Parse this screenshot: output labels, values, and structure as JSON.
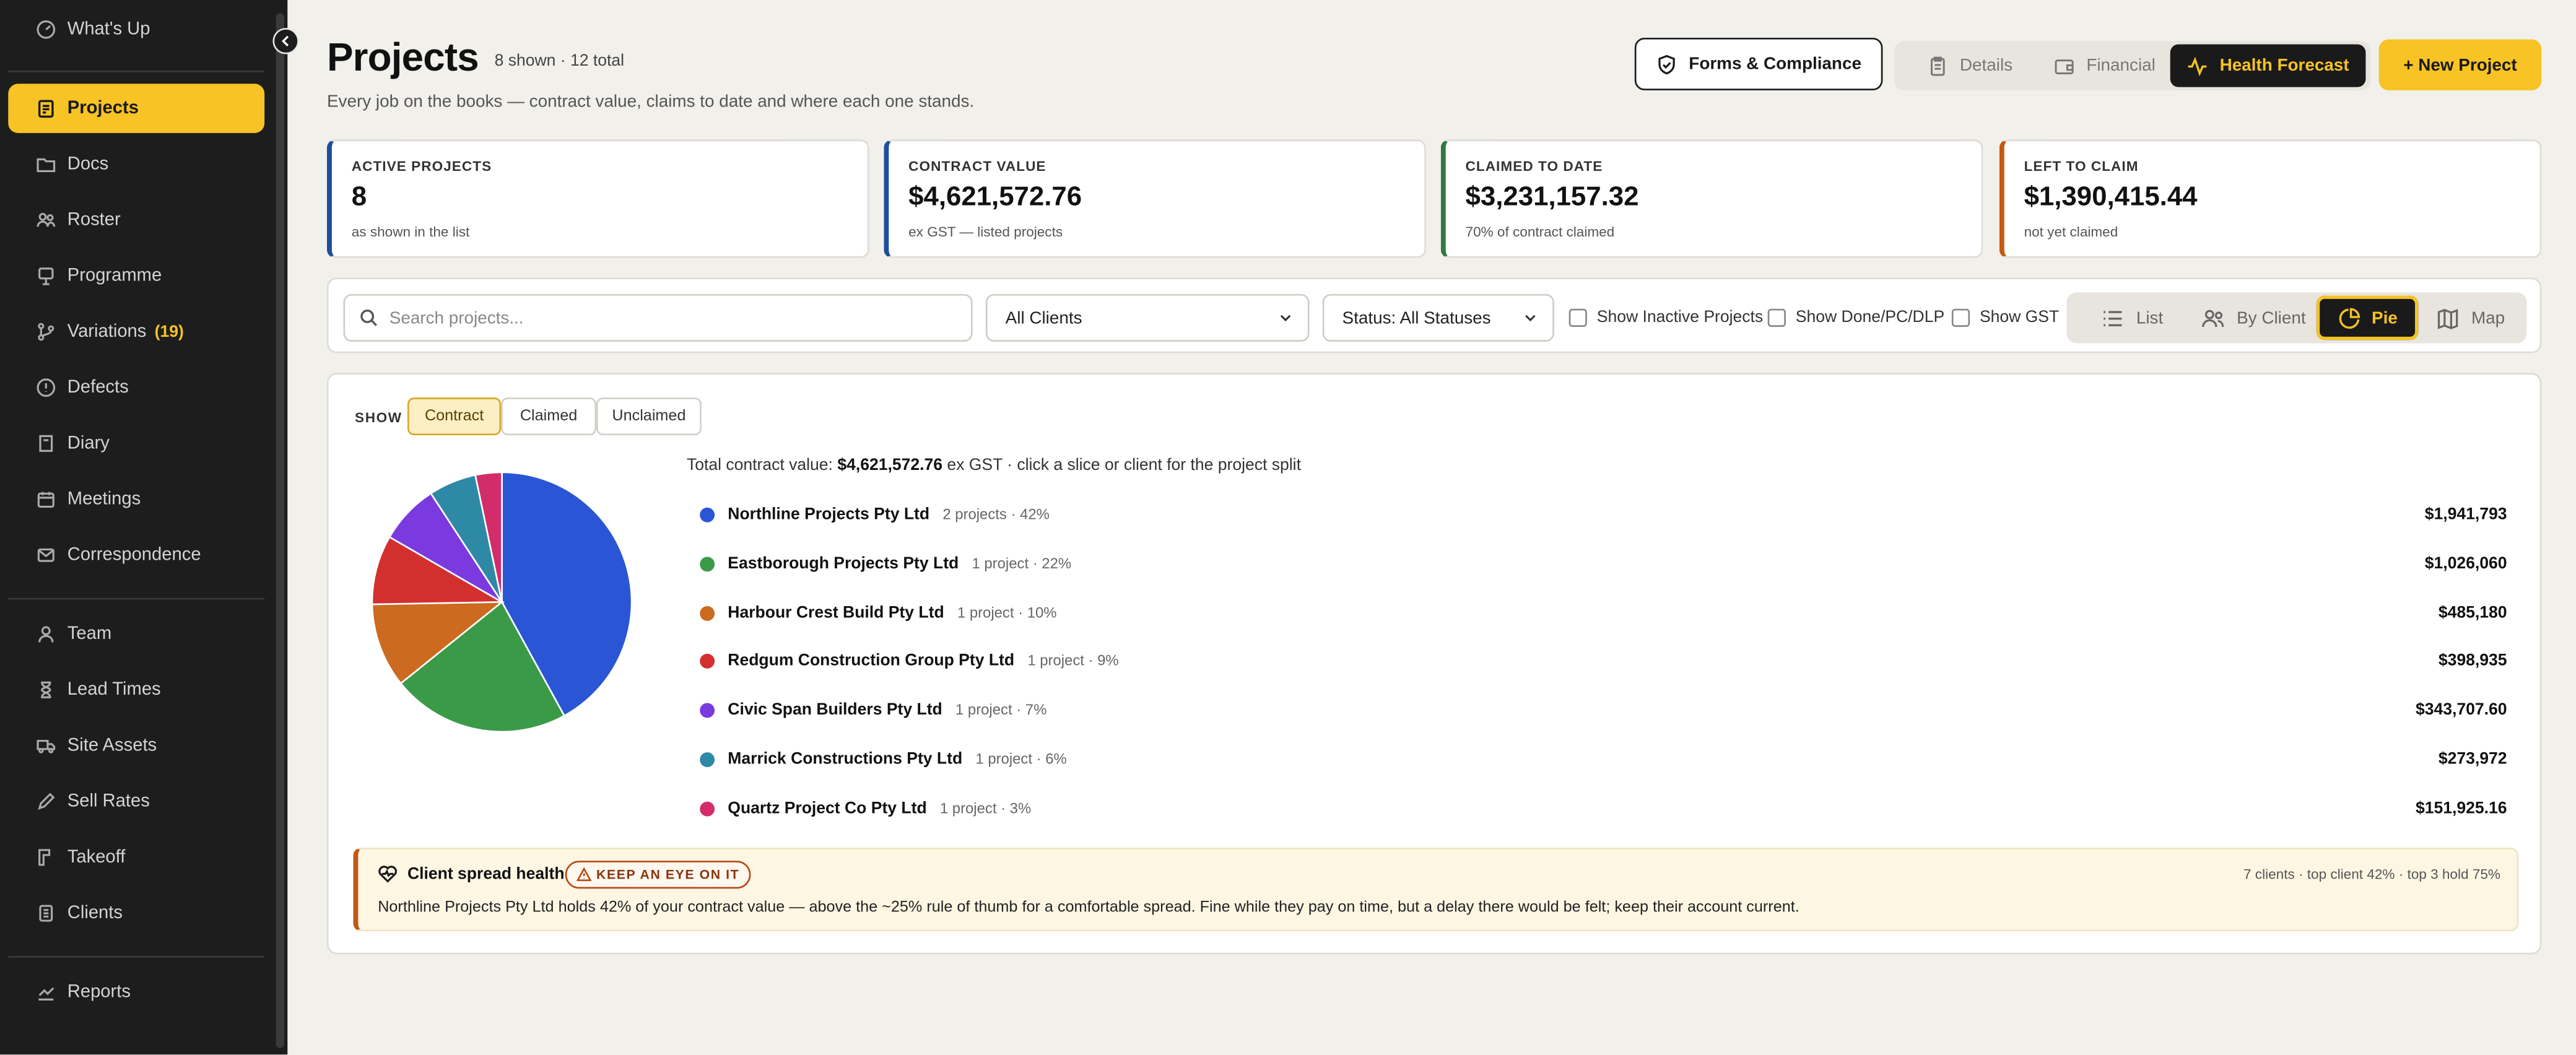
{
  "sidebar": {
    "items": [
      {
        "label": "What's Up",
        "icon": "gauge-icon"
      },
      {
        "label": "Projects",
        "icon": "clipboard-icon",
        "active": true
      },
      {
        "label": "Docs",
        "icon": "folder-icon"
      },
      {
        "label": "Roster",
        "icon": "people-icon"
      },
      {
        "label": "Programme",
        "icon": "presentation-icon"
      },
      {
        "label": "Variations",
        "icon": "branch-icon",
        "badge": "(19)"
      },
      {
        "label": "Defects",
        "icon": "alert-circle-icon"
      },
      {
        "label": "Diary",
        "icon": "book-icon"
      },
      {
        "label": "Meetings",
        "icon": "calendar-icon"
      },
      {
        "label": "Correspondence",
        "icon": "mail-icon"
      },
      {
        "label": "Team",
        "icon": "user-icon"
      },
      {
        "label": "Lead Times",
        "icon": "hourglass-icon"
      },
      {
        "label": "Site Assets",
        "icon": "truck-icon"
      },
      {
        "label": "Sell Rates",
        "icon": "pencil-icon"
      },
      {
        "label": "Takeoff",
        "icon": "ruler-icon"
      },
      {
        "label": "Clients",
        "icon": "document-icon"
      },
      {
        "label": "Reports",
        "icon": "chart-line-icon"
      }
    ]
  },
  "header": {
    "title": "Projects",
    "count": "8 shown · 12 total",
    "subtitle": "Every job on the books — contract value, claims to date and where each one stands.",
    "forms_label": "Forms & Compliance",
    "tabs": {
      "details": "Details",
      "financial": "Financial",
      "health": "Health Forecast"
    },
    "new_label": "+ New Project"
  },
  "stats": {
    "active": {
      "label": "ACTIVE PROJECTS",
      "value": "8",
      "note": "as shown in the list",
      "accent": "#1f4e9c"
    },
    "contract": {
      "label": "CONTRACT VALUE",
      "value": "$4,621,572.76",
      "note": "ex GST — listed projects",
      "accent": "#1f4e9c"
    },
    "claimed": {
      "label": "CLAIMED TO DATE",
      "value": "$3,231,157.32",
      "note": "70% of contract claimed",
      "accent": "#2e7a3d"
    },
    "left": {
      "label": "LEFT TO CLAIM",
      "value": "$1,390,415.44",
      "note": "not yet claimed",
      "accent": "#c25a12"
    }
  },
  "filters": {
    "search_placeholder": "Search projects...",
    "clients": "All Clients",
    "status": "Status: All Statuses",
    "inactive": "Show Inactive Projects",
    "done": "Show Done/PC/DLP",
    "gst": "Show GST",
    "views": {
      "list": "List",
      "by_client": "By Client",
      "pie": "Pie",
      "map": "Map"
    }
  },
  "pie_panel": {
    "show_label": "SHOW",
    "toggles": {
      "contract": "Contract",
      "claimed": "Claimed",
      "unclaimed": "Unclaimed"
    },
    "total_prefix": "Total contract value: ",
    "total_value": "$4,621,572.76",
    "total_suffix": " ex GST · click a slice or client for the project split"
  },
  "chart_data": {
    "type": "pie",
    "title": "",
    "slices": [
      {
        "name": "Northline Projects Pty Ltd",
        "meta": "2 projects · 42%",
        "amount_label": "$1,941,793",
        "value": 1941793,
        "color": "#2a56d6"
      },
      {
        "name": "Eastborough Projects Pty Ltd",
        "meta": "1 project · 22%",
        "amount_label": "$1,026,060",
        "value": 1026060,
        "color": "#3a9a48"
      },
      {
        "name": "Harbour Crest Build Pty Ltd",
        "meta": "1 project · 10%",
        "amount_label": "$485,180",
        "value": 485180,
        "color": "#cc6a1f"
      },
      {
        "name": "Redgum Construction Group Pty Ltd",
        "meta": "1 project · 9%",
        "amount_label": "$398,935",
        "value": 398935,
        "color": "#d42f2f"
      },
      {
        "name": "Civic Span Builders Pty Ltd",
        "meta": "1 project · 7%",
        "amount_label": "$343,707.60",
        "value": 343707.6,
        "color": "#7a3ae0"
      },
      {
        "name": "Marrick Constructions Pty Ltd",
        "meta": "1 project · 6%",
        "amount_label": "$273,972",
        "value": 273972,
        "color": "#2e89a6"
      },
      {
        "name": "Quartz Project Co Pty Ltd",
        "meta": "1 project · 3%",
        "amount_label": "$151,925.16",
        "value": 151925.16,
        "color": "#d22d6a"
      }
    ]
  },
  "health": {
    "title": "Client spread health",
    "badge": "KEEP AN EYE ON IT",
    "stats": "7 clients · top client 42% · top 3 hold 75%",
    "text": "Northline Projects Pty Ltd holds 42% of your contract value — above the ~25% rule of thumb for a comfortable spread. Fine while they pay on time, but a delay there would be felt; keep their account current."
  }
}
